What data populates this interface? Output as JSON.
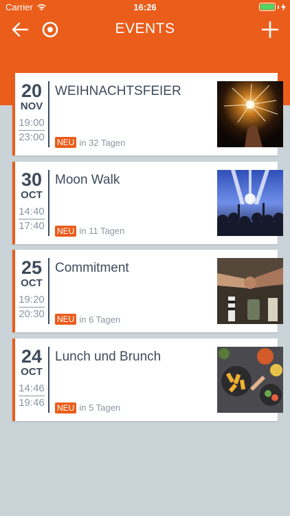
{
  "status_bar": {
    "carrier": "Carrier",
    "time": "16:26",
    "battery_color": "#4cd964"
  },
  "nav": {
    "title": "EVENTS",
    "back_icon": "arrow-left-icon",
    "target_icon": "target-icon",
    "add_icon": "plus-icon"
  },
  "colors": {
    "accent": "#ea5d1b",
    "text_dark": "#3d4a5c",
    "text_muted": "#8a95a2",
    "background": "#c9d3d8"
  },
  "events": [
    {
      "day": "20",
      "month": "NOV",
      "start": "19:00",
      "end": "23:00",
      "title": "WEIHNACHTSFEIER",
      "badge": "NEU",
      "days_until": "in 32 Tagen",
      "image_icon": "sparkler-photo"
    },
    {
      "day": "30",
      "month": "OCT",
      "start": "14:40",
      "end": "17:40",
      "title": "Moon Walk",
      "badge": "NEU",
      "days_until": "in 11 Tagen",
      "image_icon": "concert-photo"
    },
    {
      "day": "25",
      "month": "OCT",
      "start": "19:20",
      "end": "20:30",
      "title": "Commitment",
      "badge": "NEU",
      "days_until": "in 6 Tagen",
      "image_icon": "fist-bump-photo"
    },
    {
      "day": "24",
      "month": "OCT",
      "start": "14:46",
      "end": "19:46",
      "title": "Lunch und Brunch",
      "badge": "NEU",
      "days_until": "in 5 Tagen",
      "image_icon": "brunch-photo"
    }
  ]
}
